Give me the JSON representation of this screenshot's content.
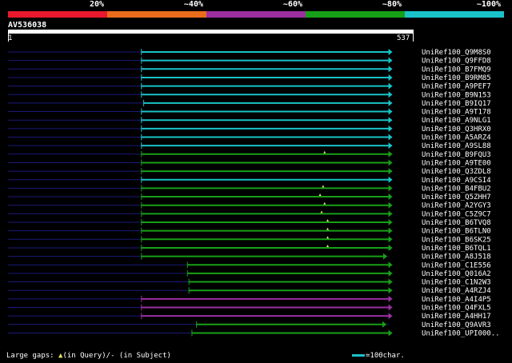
{
  "scale": {
    "segments": [
      {
        "label": "20%",
        "color": "#e8192c"
      },
      {
        "label": "~40%",
        "color": "#e86c1c"
      },
      {
        "label": "~60%",
        "color": "#9c2fa0"
      },
      {
        "label": "~80%",
        "color": "#17a017"
      },
      {
        "label": "~100%",
        "color": "#19c3c8"
      }
    ]
  },
  "query": {
    "title": "AV536038",
    "length": 537,
    "start_label": "1",
    "end_label": "537"
  },
  "colors": {
    "cyan": "#19c3c8",
    "green": "#17a017",
    "purple": "#9c2fa0",
    "baseline": "#1a1a7a",
    "gap_marker": "#e8e060"
  },
  "chart_data": {
    "type": "alignment-overview",
    "query_length": 537,
    "hits": [
      {
        "name": "UniRef100_Q9M8S0",
        "start": 177,
        "end": 510,
        "color": "cyan"
      },
      {
        "name": "UniRef100_Q9FFD8",
        "start": 177,
        "end": 510,
        "color": "cyan"
      },
      {
        "name": "UniRef100_B7FMQ9",
        "start": 177,
        "end": 510,
        "color": "cyan"
      },
      {
        "name": "UniRef100_B9RM85",
        "start": 177,
        "end": 510,
        "color": "cyan"
      },
      {
        "name": "UniRef100_A9PEF7",
        "start": 177,
        "end": 510,
        "color": "cyan"
      },
      {
        "name": "UniRef100_B9N153",
        "start": 177,
        "end": 510,
        "color": "cyan"
      },
      {
        "name": "UniRef100_B9IQ17",
        "start": 180,
        "end": 510,
        "color": "cyan"
      },
      {
        "name": "UniRef100_A9T178",
        "start": 177,
        "end": 510,
        "color": "cyan"
      },
      {
        "name": "UniRef100_A9NLG1",
        "start": 177,
        "end": 510,
        "color": "cyan"
      },
      {
        "name": "UniRef100_Q3HRX0",
        "start": 177,
        "end": 510,
        "color": "cyan"
      },
      {
        "name": "UniRef100_A5ARZ4",
        "start": 177,
        "end": 510,
        "color": "cyan"
      },
      {
        "name": "UniRef100_A9SL88",
        "start": 177,
        "end": 510,
        "color": "cyan"
      },
      {
        "name": "UniRef100_B9FQU3",
        "start": 177,
        "end": 510,
        "color": "green",
        "gap": 420
      },
      {
        "name": "UniRef100_A9TE00",
        "start": 177,
        "end": 510,
        "color": "green"
      },
      {
        "name": "UniRef100_Q3ZDL8",
        "start": 177,
        "end": 510,
        "color": "green"
      },
      {
        "name": "UniRef100_A9CSI4",
        "start": 177,
        "end": 510,
        "color": "cyan"
      },
      {
        "name": "UniRef100_B4FBU2",
        "start": 177,
        "end": 510,
        "color": "green",
        "gap": 418
      },
      {
        "name": "UniRef100_Q5ZHH7",
        "start": 177,
        "end": 510,
        "color": "green",
        "gap": 414
      },
      {
        "name": "UniRef100_A2YGY3",
        "start": 177,
        "end": 510,
        "color": "green",
        "gap": 420
      },
      {
        "name": "UniRef100_C5Z9C7",
        "start": 177,
        "end": 510,
        "color": "green",
        "gap": 416
      },
      {
        "name": "UniRef100_B6TVQ8",
        "start": 177,
        "end": 510,
        "color": "green",
        "gap": 424
      },
      {
        "name": "UniRef100_B6TLN0",
        "start": 177,
        "end": 510,
        "color": "green",
        "gap": 424
      },
      {
        "name": "UniRef100_B6SK25",
        "start": 177,
        "end": 510,
        "color": "green",
        "gap": 424
      },
      {
        "name": "UniRef100_B6TQL1",
        "start": 177,
        "end": 510,
        "color": "green",
        "gap": 424
      },
      {
        "name": "UniRef100_A8J518",
        "start": 177,
        "end": 503,
        "color": "green"
      },
      {
        "name": "UniRef100_C1E556",
        "start": 238,
        "end": 510,
        "color": "green"
      },
      {
        "name": "UniRef100_Q016A2",
        "start": 238,
        "end": 510,
        "color": "green"
      },
      {
        "name": "UniRef100_C1N2W3",
        "start": 240,
        "end": 510,
        "color": "green"
      },
      {
        "name": "UniRef100_A4RZJ4",
        "start": 240,
        "end": 510,
        "color": "green"
      },
      {
        "name": "UniRef100_A4I4P5",
        "start": 177,
        "end": 510,
        "color": "purple"
      },
      {
        "name": "UniRef100_Q4FXL5",
        "start": 177,
        "end": 510,
        "color": "purple"
      },
      {
        "name": "UniRef100_A4HH17",
        "start": 177,
        "end": 510,
        "color": "purple"
      },
      {
        "name": "UniRef100_Q9AVR3",
        "start": 250,
        "end": 502,
        "color": "green"
      },
      {
        "name": "UniRef100_UPI000..",
        "start": 244,
        "end": 510,
        "color": "green"
      }
    ]
  },
  "footer": {
    "large_gaps_text": "Large gaps:",
    "triangle": "▲",
    "in_query": "(in Query)/",
    "dash": "-",
    "in_subject": " (in Subject)",
    "scale_text": "=100char."
  }
}
